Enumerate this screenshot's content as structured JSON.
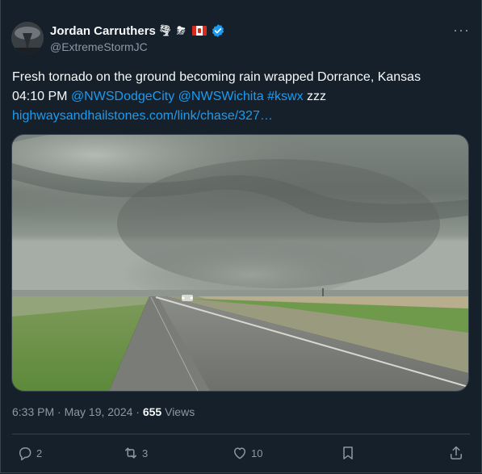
{
  "author": {
    "display_name": "Jordan Carruthers",
    "handle": "@ExtremeStormJC",
    "badge_icons": [
      "tornado-emoji",
      "thunder-cloud-emoji",
      "canada-flag-emoji",
      "verified-badge"
    ]
  },
  "tweet": {
    "line1": "Fresh tornado on the ground becoming rain wrapped Dorrance, Kansas",
    "time_prefix": "04:10 PM ",
    "mention1": "@NWSDodgeCity",
    "mention2": "@NWSWichita",
    "hashtag": "#kswx",
    "suffix": " zzz",
    "link": "highwaysandhailstones.com/link/chase/327…"
  },
  "meta": {
    "timestamp": "6:33 PM · May 19, 2024 · ",
    "views_count": "655",
    "views_label": " Views"
  },
  "actions": {
    "replies": "2",
    "reposts": "3",
    "likes": "10"
  },
  "colors": {
    "background": "#15202b",
    "link": "#1d9bf0",
    "muted": "#8b98a5",
    "verified": "#1d9bf0"
  }
}
